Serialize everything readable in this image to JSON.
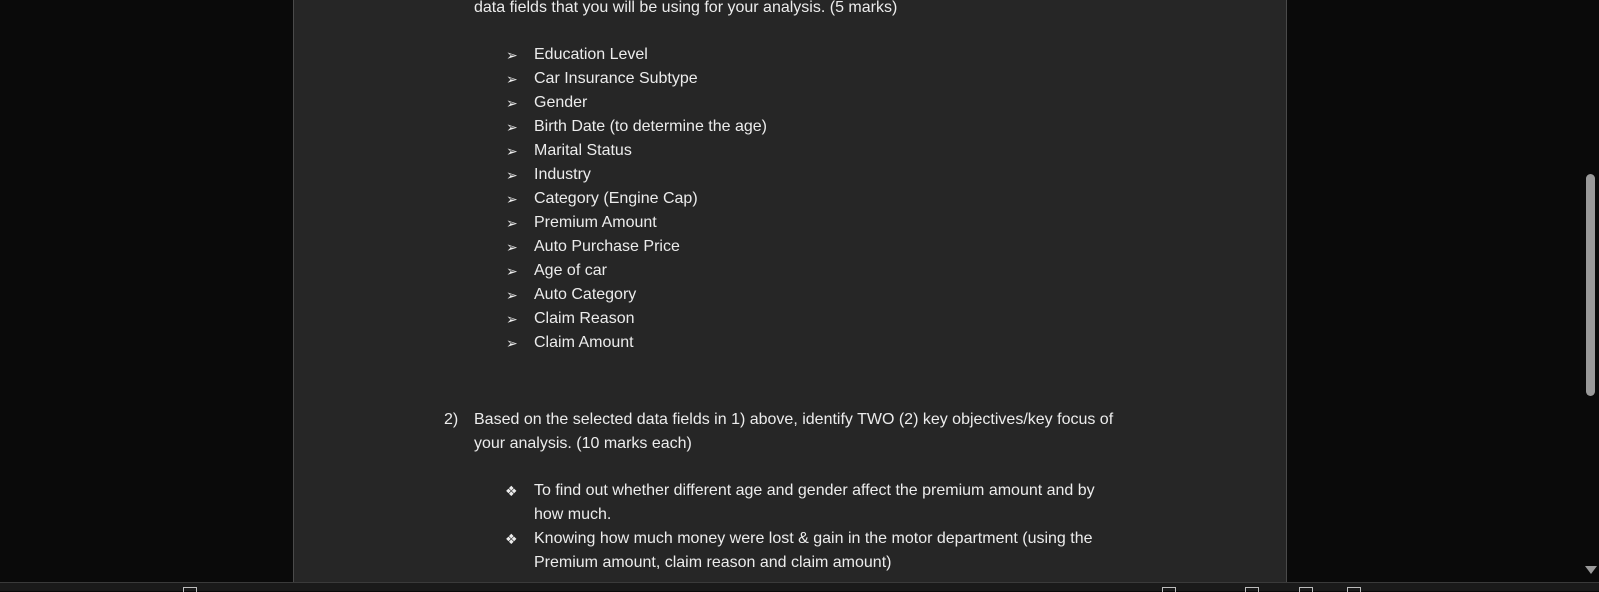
{
  "document": {
    "intro_line": "data fields that you will be using for your analysis. (5 marks)",
    "arrow_glyph": "➢",
    "diamond_glyph": "❖",
    "data_fields": [
      "Education Level",
      "Car Insurance Subtype",
      "Gender",
      "Birth Date (to determine the age)",
      "Marital Status",
      "Industry",
      "Category (Engine Cap)",
      "Premium Amount",
      "Auto Purchase Price",
      "Age of car",
      "Auto Category",
      "Claim Reason",
      "Claim Amount"
    ],
    "question2": {
      "number": "2)",
      "line1": "Based on the selected data fields in 1) above, identify TWO (2) key objectives/key focus of",
      "line2": "your analysis. (10 marks each)"
    },
    "objectives": [
      {
        "line1": "To find out whether different age and gender affect the premium amount and by",
        "line2": "how much."
      },
      {
        "line1": "Knowing how much money were lost & gain in the motor department (using the",
        "line2": "Premium amount, claim reason and claim amount)"
      }
    ]
  },
  "icons": {
    "scroll_down": "scroll-down-arrow-icon"
  }
}
